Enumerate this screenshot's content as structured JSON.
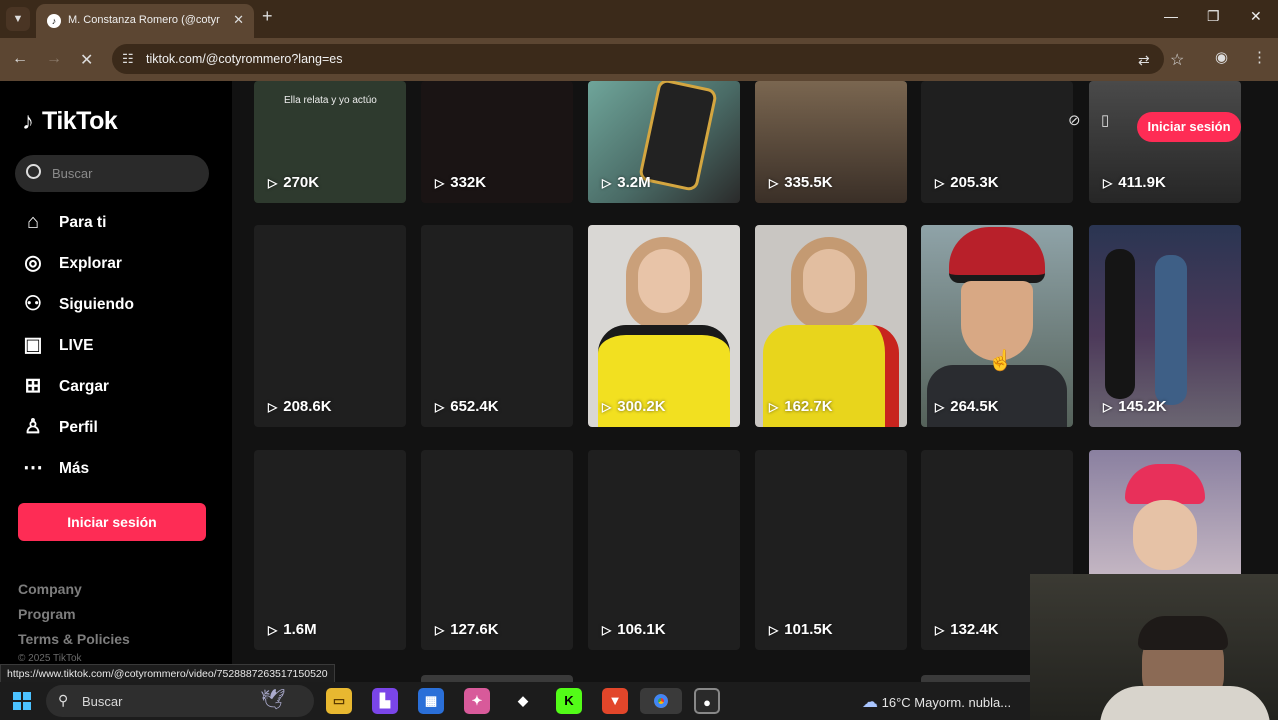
{
  "browser": {
    "tab_title": "M. Constanza Romero (@cotyr",
    "tab_close": "✕",
    "new_tab": "+",
    "url": "tiktok.com/@cotyrommero?lang=es"
  },
  "sidebar": {
    "logo_text": "TikTok",
    "search_placeholder": "Buscar",
    "nav": [
      {
        "label": "Para ti",
        "icon": "home-icon"
      },
      {
        "label": "Explorar",
        "icon": "compass-icon"
      },
      {
        "label": "Siguiendo",
        "icon": "following-icon"
      },
      {
        "label": "LIVE",
        "icon": "live-icon"
      },
      {
        "label": "Cargar",
        "icon": "upload-icon"
      },
      {
        "label": "Perfil",
        "icon": "profile-icon"
      },
      {
        "label": "Más",
        "icon": "more-icon"
      }
    ],
    "login_label": "Iniciar sesión",
    "footer": [
      "Company",
      "Program",
      "Terms & Policies"
    ],
    "copyright": "© 2025 TikTok"
  },
  "header": {
    "login_label": "Iniciar sesión"
  },
  "videos": {
    "row1": [
      {
        "views": "270K",
        "caption": "Ella relata y yo actúo"
      },
      {
        "views": "332K"
      },
      {
        "views": "3.2M"
      },
      {
        "views": "335.5K"
      },
      {
        "views": "205.3K"
      },
      {
        "views": "411.9K"
      }
    ],
    "row2": [
      {
        "views": "208.6K"
      },
      {
        "views": "652.4K"
      },
      {
        "views": "300.2K"
      },
      {
        "views": "162.7K"
      },
      {
        "views": "264.5K"
      },
      {
        "views": "145.2K"
      }
    ],
    "row3": [
      {
        "views": "1.6M"
      },
      {
        "views": "127.6K"
      },
      {
        "views": "106.1K"
      },
      {
        "views": "101.5K"
      },
      {
        "views": "132.4K"
      }
    ]
  },
  "status_link": "https://www.tiktok.com/@cotyrommero/video/7528887263517150520",
  "taskbar": {
    "search_placeholder": "Buscar",
    "temperature": "16°C",
    "weather_desc": "Mayorm. nubla..."
  }
}
